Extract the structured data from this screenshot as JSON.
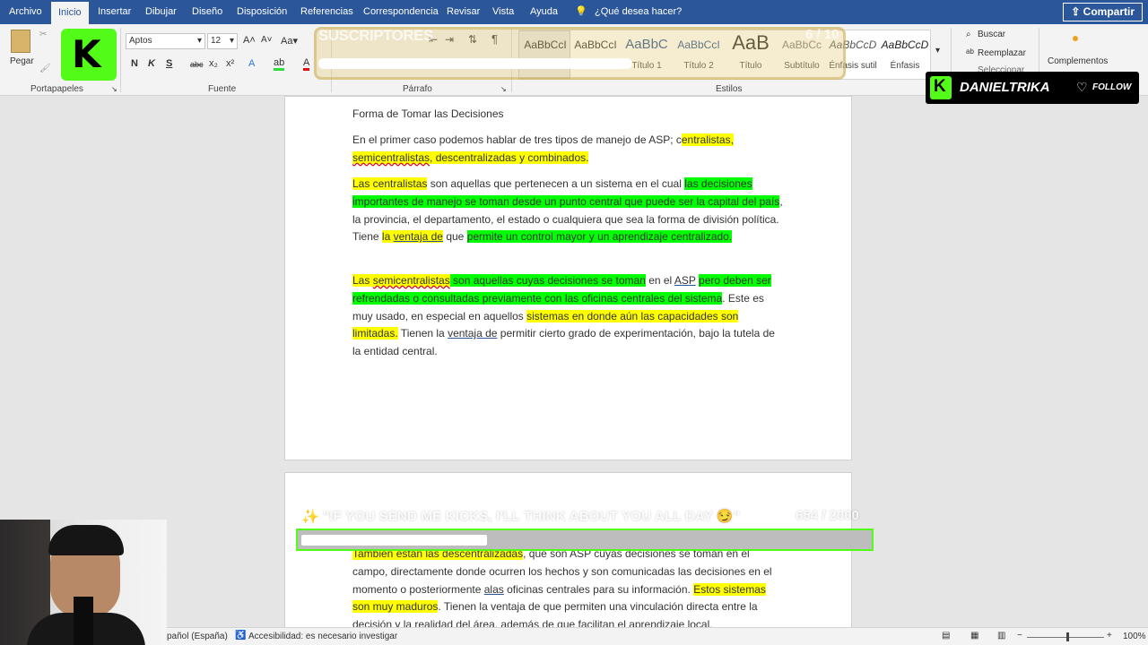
{
  "tabs": [
    "Archivo",
    "Inicio",
    "Insertar",
    "Dibujar",
    "Diseño",
    "Disposición",
    "Referencias",
    "Correspondencia",
    "Revisar",
    "Vista",
    "Ayuda"
  ],
  "tell_me": "¿Qué desea hacer?",
  "share_label": "Compartir",
  "clipboard": {
    "paste_label": "Pegar",
    "group": "Portapapeles"
  },
  "font": {
    "name": "Aptos",
    "size": "12",
    "group": "Fuente",
    "buttons": [
      "N",
      "K",
      "S",
      "abc",
      "x₂",
      "x²"
    ]
  },
  "paragraph": {
    "group": "Párrafo"
  },
  "styles": {
    "group": "Estilos",
    "items": [
      {
        "sample": "AaBbCcI",
        "name": ""
      },
      {
        "sample": "AaBbCcI",
        "name": ""
      },
      {
        "sample": "AaBbC",
        "name": "Título 1"
      },
      {
        "sample": "AaBbCcI",
        "name": "Título 2"
      },
      {
        "sample": "AaB",
        "name": "Título"
      },
      {
        "sample": "AaBbCc",
        "name": "Subtítulo"
      },
      {
        "sample": "AaBbCcD",
        "name": "Énfasis sutil"
      },
      {
        "sample": "AaBbCcD",
        "name": "Énfasis"
      }
    ]
  },
  "editing": {
    "search": "Buscar",
    "replace": "Reemplazar",
    "select": "Seleccionar"
  },
  "addins": {
    "label": "Complementos"
  },
  "overlay": {
    "subs_label": "SUSCRIPTORES",
    "subs_count": "6 / 10",
    "goal_text": "\"IF YOU SEND ME KICKS, I'LL THINK ABOUT YOU ALL DAY 😏\"",
    "goal_count": "654 / 2000",
    "goal_progress": 0.327,
    "streamer": "DANIELTRIKA",
    "follow": "FOLLOW"
  },
  "document": {
    "heading": "Forma de Tomar las Decisiones",
    "p1": [
      "En el primer caso podemos hablar de tres tipos de manejo de ASP; c",
      "entralistas, ",
      "semicentralistas",
      ", descentralizadas y combinados."
    ],
    "p2": [
      "Las centralistas",
      " son aquellas que pertenecen a un sistema  en el cual ",
      "las decisiones importantes de manejo se toman desde un punto central que puede ser la capital del país",
      ", la provincia, el departamento, el estado o cualquiera que sea la forma de división política. Tiene ",
      "la ",
      "ventaja  de",
      " que ",
      "permite un control mayor y un aprendizaje centralizado."
    ],
    "p3": [
      "Las ",
      "semicentralistas",
      " son aquellas cuyas decisiones se toman",
      " en el ",
      "ASP",
      " ",
      "pero deben ser refrendadas o consultadas previamente con las oficinas centrales del sistema",
      ". Este es muy usado, en especial en aquellos ",
      "sistemas en donde aún las capacidades son limitadas.",
      " Tienen la ",
      "ventaja  de",
      " permitir cierto grado de experimentación, bajo la tutela de la entidad central."
    ],
    "p4": [
      "También están las descentralizadas",
      ", que son ASP cuyas decisiones se toman en el campo, directamente donde ocurren los hechos y son comunicadas las decisiones en el momento o posteriormente ",
      "alas",
      " oficinas centrales para su información. ",
      "Estos sistemas son muy maduros",
      ". Tienen la ventaja de que permiten una vinculación directa entre la decisión y la realidad del área, además de que facilitan el aprendizaje local."
    ]
  },
  "status": {
    "language": "pañol (España)",
    "accessibility": "Accesibilidad: es necesario investigar",
    "zoom": "100%"
  },
  "colors": {
    "word_blue": "#2b579a",
    "highlight_yellow": "#ffff00",
    "highlight_green": "#00ff00",
    "kick_green": "#53fc18"
  }
}
